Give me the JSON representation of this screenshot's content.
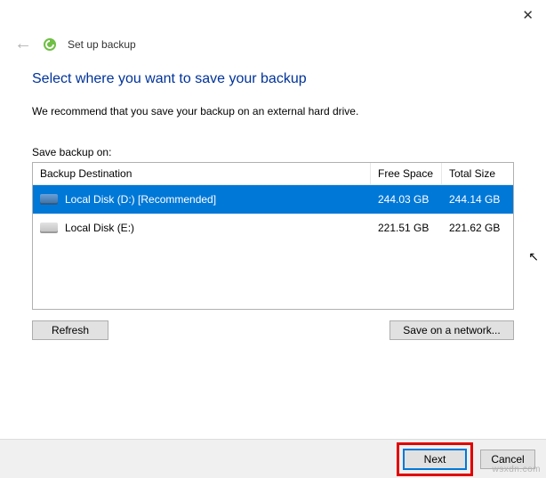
{
  "window": {
    "title": "Set up backup"
  },
  "page": {
    "heading": "Select where you want to save your backup",
    "subhead": "We recommend that you save your backup on an external hard drive.",
    "save_label": "Save backup on:"
  },
  "table": {
    "headers": {
      "dest": "Backup Destination",
      "free": "Free Space",
      "total": "Total Size"
    },
    "rows": [
      {
        "label": "Local Disk (D:) [Recommended]",
        "free": "244.03 GB",
        "total": "244.14 GB",
        "selected": true
      },
      {
        "label": "Local Disk (E:)",
        "free": "221.51 GB",
        "total": "221.62 GB",
        "selected": false
      }
    ]
  },
  "buttons": {
    "refresh": "Refresh",
    "network": "Save on a network...",
    "next": "Next",
    "cancel": "Cancel"
  },
  "watermark": "wsxdn.com"
}
